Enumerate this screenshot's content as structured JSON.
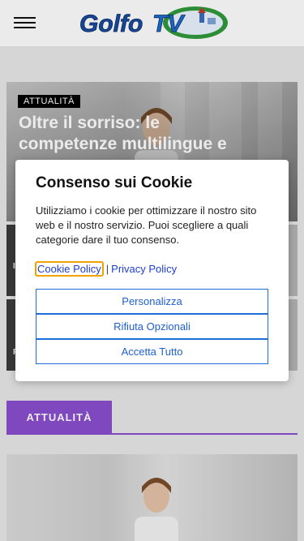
{
  "header": {
    "logo_text": "GolfoTV",
    "menu_icon": "hamburger-icon"
  },
  "hero": {
    "category": "ATTUALITÀ",
    "title": "Oltre il sorriso: le competenze multilingue e"
  },
  "section": {
    "tab_label": "ATTUALITÀ"
  },
  "cookie_modal": {
    "title": "Consenso sui Cookie",
    "body": "Utilizziamo i cookie per ottimizzare il nostro sito web e il nostro servizio. Puoi scegliere a quali categorie dare il tuo consenso.",
    "cookie_policy_link": "Cookie Policy",
    "separator": "|",
    "privacy_policy_link": "Privacy Policy",
    "btn_customize": "Personalizza",
    "btn_reject": "Rifiuta Opzionali",
    "btn_accept": "Accetta Tutto"
  },
  "colors": {
    "accent": "#8a4fd0",
    "link": "#1e3ed0",
    "button_border": "#1e6ed8",
    "focus_ring": "#f0a202"
  }
}
